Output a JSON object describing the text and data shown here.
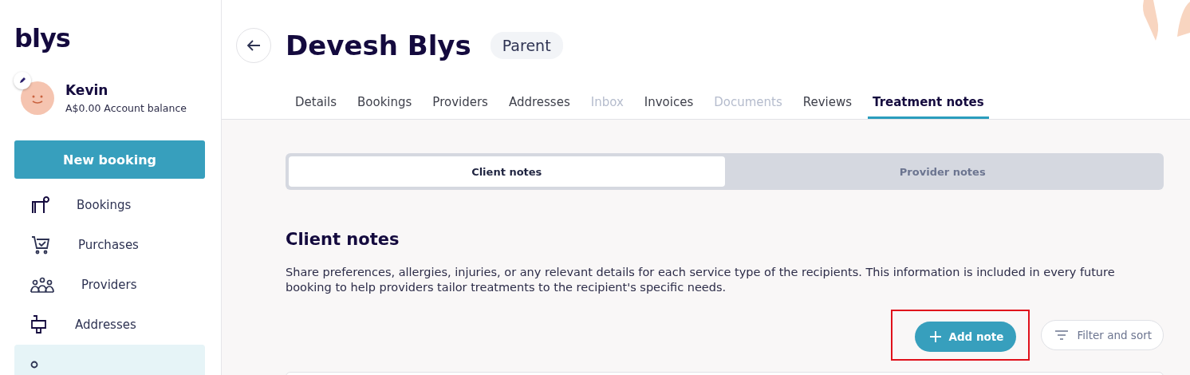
{
  "sidebar": {
    "logo": "blys",
    "user": {
      "name": "Kevin",
      "balance": "A$0.00 Account balance"
    },
    "new_booking": "New booking",
    "items": [
      {
        "kind": "bookings",
        "label": "Bookings",
        "selected": false
      },
      {
        "kind": "purchases",
        "label": "Purchases",
        "selected": false
      },
      {
        "kind": "providers",
        "label": "Providers",
        "selected": false
      },
      {
        "kind": "addresses",
        "label": "Addresses",
        "selected": false
      },
      {
        "kind": "recipients",
        "selected": true
      }
    ]
  },
  "header": {
    "title": "Devesh Blys",
    "badge": "Parent"
  },
  "tabs": [
    {
      "label": "Details",
      "selected": false,
      "disabled": false
    },
    {
      "label": "Bookings",
      "selected": false,
      "disabled": false
    },
    {
      "label": "Providers",
      "selected": false,
      "disabled": false
    },
    {
      "label": "Addresses",
      "selected": false,
      "disabled": false
    },
    {
      "label": "Inbox",
      "selected": false,
      "disabled": true
    },
    {
      "label": "Invoices",
      "selected": false,
      "disabled": false
    },
    {
      "label": "Documents",
      "selected": false,
      "disabled": true
    },
    {
      "label": "Reviews",
      "selected": false,
      "disabled": false
    },
    {
      "label": "Treatment notes",
      "selected": true,
      "disabled": false
    }
  ],
  "segments": [
    {
      "label": "Client notes",
      "selected": true
    },
    {
      "label": "Provider notes",
      "selected": false
    }
  ],
  "section": {
    "title": "Client notes",
    "description": "Share preferences, allergies, injuries, or any relevant details for each service type of the recipients. This information is included in every future booking to help providers tailor treatments to the recipient's specific needs."
  },
  "actions": {
    "add_note": {
      "label": "Add note",
      "highlighted": true
    },
    "filter": "Filter and sort"
  }
}
